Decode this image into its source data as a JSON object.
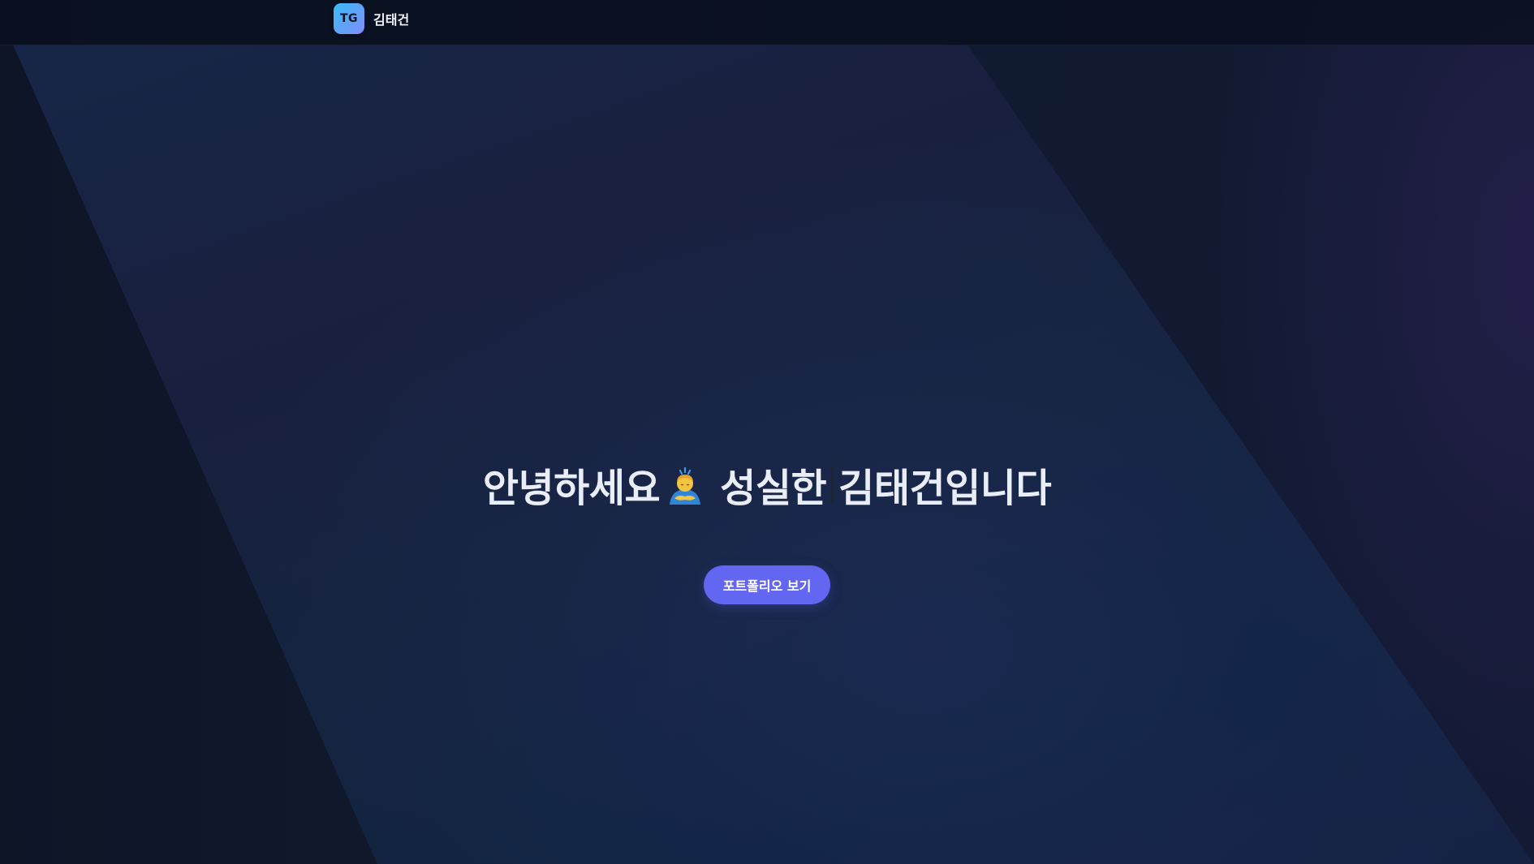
{
  "header": {
    "logo_text": "TG",
    "brand_name": "김태건"
  },
  "hero": {
    "greeting": "안녕하세요",
    "emoji_icon": "person-bowing-icon",
    "tagline_part1": "성실한",
    "tagline_part2": "김태건입니다",
    "cta_label": "포트폴리오 보기"
  },
  "colors": {
    "background": "#0f1629",
    "accent_button": "#6366f1",
    "logo_gradient_start": "#38bdf8",
    "logo_gradient_end": "#818cf8",
    "headline_text": "#e9edf5"
  }
}
